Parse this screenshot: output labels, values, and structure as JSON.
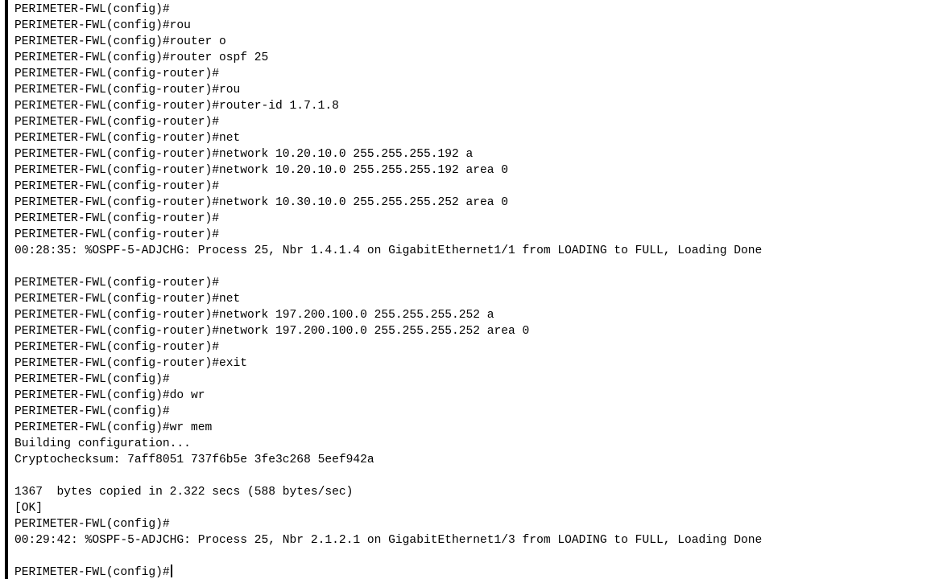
{
  "terminal": {
    "lines": [
      "[OK]",
      "PERIMETER-FWL(config)#",
      "PERIMETER-FWL(config)#rou",
      "PERIMETER-FWL(config)#router o",
      "PERIMETER-FWL(config)#router ospf 25",
      "PERIMETER-FWL(config-router)#",
      "PERIMETER-FWL(config-router)#rou",
      "PERIMETER-FWL(config-router)#router-id 1.7.1.8",
      "PERIMETER-FWL(config-router)#",
      "PERIMETER-FWL(config-router)#net",
      "PERIMETER-FWL(config-router)#network 10.20.10.0 255.255.255.192 a",
      "PERIMETER-FWL(config-router)#network 10.20.10.0 255.255.255.192 area 0",
      "PERIMETER-FWL(config-router)#",
      "PERIMETER-FWL(config-router)#network 10.30.10.0 255.255.255.252 area 0",
      "PERIMETER-FWL(config-router)#",
      "PERIMETER-FWL(config-router)#",
      "00:28:35: %OSPF-5-ADJCHG: Process 25, Nbr 1.4.1.4 on GigabitEthernet1/1 from LOADING to FULL, Loading Done",
      "",
      "PERIMETER-FWL(config-router)#",
      "PERIMETER-FWL(config-router)#net",
      "PERIMETER-FWL(config-router)#network 197.200.100.0 255.255.255.252 a",
      "PERIMETER-FWL(config-router)#network 197.200.100.0 255.255.255.252 area 0",
      "PERIMETER-FWL(config-router)#",
      "PERIMETER-FWL(config-router)#exit",
      "PERIMETER-FWL(config)#",
      "PERIMETER-FWL(config)#do wr",
      "PERIMETER-FWL(config)#",
      "PERIMETER-FWL(config)#wr mem",
      "Building configuration...",
      "Cryptochecksum: 7aff8051 737f6b5e 3fe3c268 5eef942a",
      "",
      "1367  bytes copied in 2.322 secs (588 bytes/sec)",
      "[OK]",
      "PERIMETER-FWL(config)#",
      "00:29:42: %OSPF-5-ADJCHG: Process 25, Nbr 2.1.2.1 on GigabitEthernet1/3 from LOADING to FULL, Loading Done",
      "",
      "PERIMETER-FWL(config)#"
    ]
  }
}
